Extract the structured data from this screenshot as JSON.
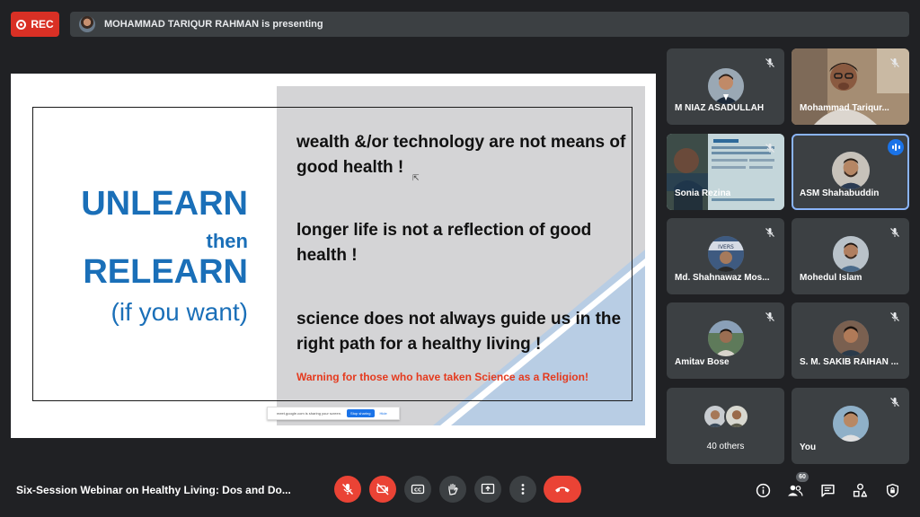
{
  "recording": {
    "label": "REC"
  },
  "presenter_banner": {
    "text": "MOHAMMAD TARIQUR RAHMAN is presenting"
  },
  "slide": {
    "headline_1": "UNLEARN",
    "headline_2": "then",
    "headline_3": "RELEARN",
    "headline_4": "(if you want)",
    "statement_1": "wealth &/or technology are not means of good health !",
    "statement_2": "longer life is not a reflection of good health !",
    "statement_3": "science does not always guide us in the right path for a healthy living !",
    "warning": "Warning for those who have taken Science as a Religion!",
    "share_notice": {
      "text": "meet.google.com is sharing your screen.",
      "stop_label": "Stop sharing",
      "hide_label": "Hide"
    }
  },
  "participants": [
    {
      "name": "M NIAZ ASADULLAH",
      "muted": true
    },
    {
      "name": "Mohammad Tariqur...",
      "muted": true
    },
    {
      "name": "Sonia Rezina",
      "muted": true
    },
    {
      "name": "ASM Shahabuddin",
      "muted": false,
      "speaking": true
    },
    {
      "name": "Md. Shahnawaz Mos...",
      "muted": true
    },
    {
      "name": "Mohedul Islam",
      "muted": true
    },
    {
      "name": "Amitav Bose",
      "muted": true
    },
    {
      "name": "S. M. SAKIB RAIHAN ...",
      "muted": true
    },
    {
      "name": "40 others",
      "muted": false
    },
    {
      "name": "You",
      "muted": true
    }
  ],
  "meeting": {
    "title": "Six-Session Webinar on Healthy Living: Dos and Do...",
    "participant_count": "60"
  },
  "colors": {
    "background": "#202124",
    "tile": "#3c4043",
    "danger": "#ea4335",
    "accent": "#1a73e8",
    "slide_blue": "#1a6fb8",
    "warning_red": "#e53a1e"
  },
  "icons": {
    "controls": [
      "mic-off-icon",
      "camera-off-icon",
      "captions-icon",
      "raise-hand-icon",
      "present-icon",
      "more-options-icon",
      "hang-up-icon"
    ],
    "right": [
      "info-icon",
      "people-icon",
      "chat-icon",
      "activities-icon",
      "host-controls-icon"
    ]
  }
}
